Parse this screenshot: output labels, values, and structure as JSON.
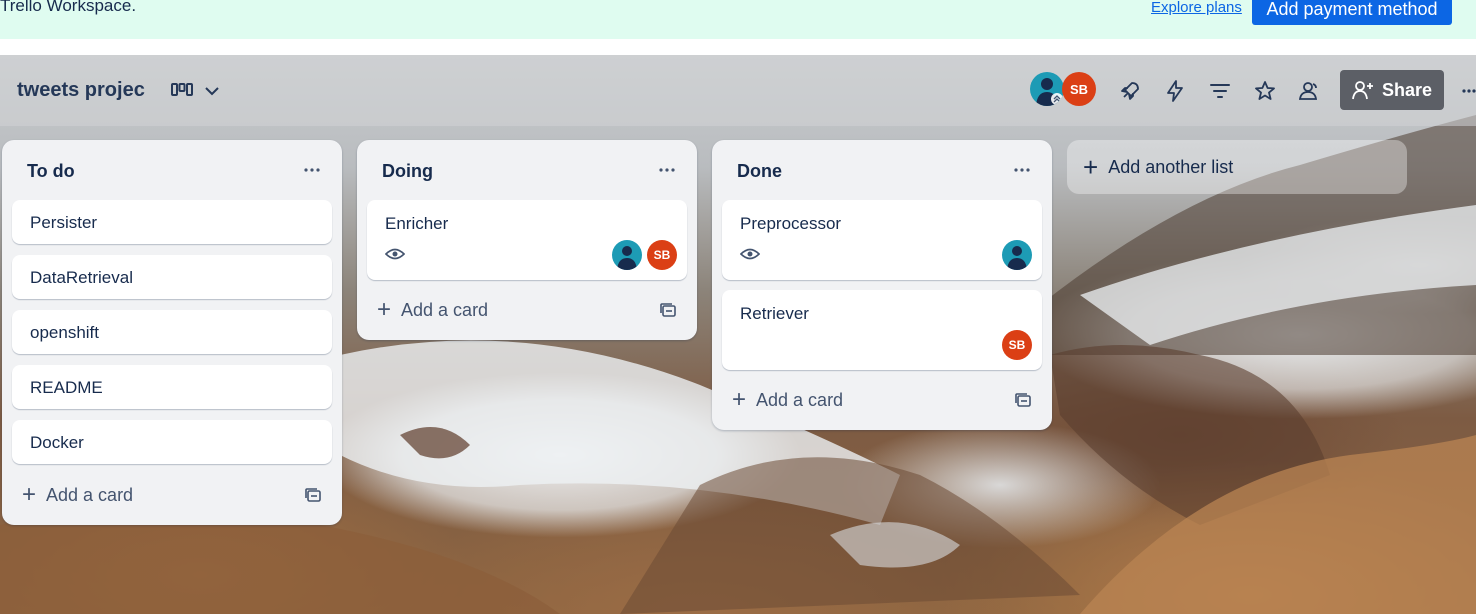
{
  "banner": {
    "text": "Trello Workspace.",
    "explore_link": "Explore plans",
    "payment_button": "Add payment method"
  },
  "board": {
    "title": "tweets projec",
    "share_label": "Share"
  },
  "header_icons": [
    "view-board-icon",
    "chevron-down-icon",
    "power-ups-icon",
    "automation-icon",
    "filter-icon",
    "star-icon",
    "visibility-icon",
    "share-icon",
    "more-icon"
  ],
  "members": [
    {
      "initials": "",
      "color": "#1d9bb5"
    },
    {
      "initials": "SB",
      "color": "#db3f15"
    }
  ],
  "lists": [
    {
      "title": "To do",
      "cards": [
        {
          "title": "Persister"
        },
        {
          "title": "DataRetrieval"
        },
        {
          "title": "openshift"
        },
        {
          "title": "README"
        },
        {
          "title": "Docker"
        }
      ],
      "add_card": "Add a card"
    },
    {
      "title": "Doing",
      "cards": [
        {
          "title": "Enricher",
          "members": [
            "person",
            "SB"
          ]
        }
      ],
      "add_card": "Add a card"
    },
    {
      "title": "Done",
      "cards": [
        {
          "title": "Preprocessor",
          "members": [
            "person"
          ]
        },
        {
          "title": "Retriever",
          "members": [
            "SB"
          ]
        }
      ],
      "add_card": "Add a card"
    }
  ],
  "add_list": "Add another list",
  "colors": {
    "banner_bg": "#dffcf0",
    "primary_button": "#0c66e4",
    "list_bg": "#f1f2f4",
    "share_button": "#5c5f66",
    "avatar_teal": "#1d9bb5",
    "avatar_red": "#db3f15"
  }
}
